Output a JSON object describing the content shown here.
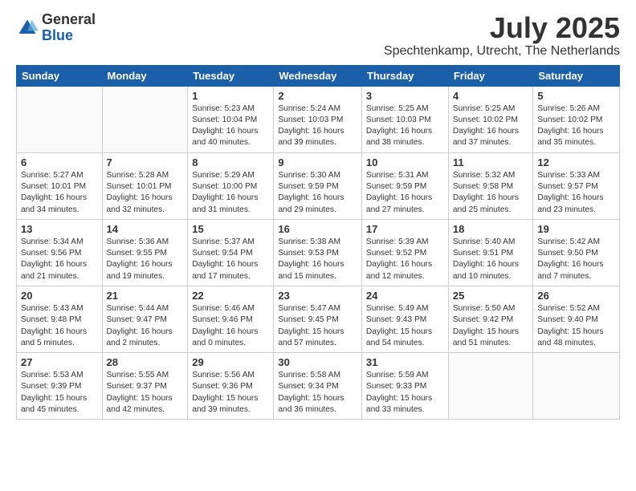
{
  "header": {
    "logo": {
      "general": "General",
      "blue": "Blue"
    },
    "title": "July 2025",
    "subtitle": "Spechtenkamp, Utrecht, The Netherlands"
  },
  "weekdays": [
    "Sunday",
    "Monday",
    "Tuesday",
    "Wednesday",
    "Thursday",
    "Friday",
    "Saturday"
  ],
  "weeks": [
    [
      {
        "day": "",
        "content": ""
      },
      {
        "day": "",
        "content": ""
      },
      {
        "day": "1",
        "content": "Sunrise: 5:23 AM\nSunset: 10:04 PM\nDaylight: 16 hours\nand 40 minutes."
      },
      {
        "day": "2",
        "content": "Sunrise: 5:24 AM\nSunset: 10:03 PM\nDaylight: 16 hours\nand 39 minutes."
      },
      {
        "day": "3",
        "content": "Sunrise: 5:25 AM\nSunset: 10:03 PM\nDaylight: 16 hours\nand 38 minutes."
      },
      {
        "day": "4",
        "content": "Sunrise: 5:25 AM\nSunset: 10:02 PM\nDaylight: 16 hours\nand 37 minutes."
      },
      {
        "day": "5",
        "content": "Sunrise: 5:26 AM\nSunset: 10:02 PM\nDaylight: 16 hours\nand 35 minutes."
      }
    ],
    [
      {
        "day": "6",
        "content": "Sunrise: 5:27 AM\nSunset: 10:01 PM\nDaylight: 16 hours\nand 34 minutes."
      },
      {
        "day": "7",
        "content": "Sunrise: 5:28 AM\nSunset: 10:01 PM\nDaylight: 16 hours\nand 32 minutes."
      },
      {
        "day": "8",
        "content": "Sunrise: 5:29 AM\nSunset: 10:00 PM\nDaylight: 16 hours\nand 31 minutes."
      },
      {
        "day": "9",
        "content": "Sunrise: 5:30 AM\nSunset: 9:59 PM\nDaylight: 16 hours\nand 29 minutes."
      },
      {
        "day": "10",
        "content": "Sunrise: 5:31 AM\nSunset: 9:59 PM\nDaylight: 16 hours\nand 27 minutes."
      },
      {
        "day": "11",
        "content": "Sunrise: 5:32 AM\nSunset: 9:58 PM\nDaylight: 16 hours\nand 25 minutes."
      },
      {
        "day": "12",
        "content": "Sunrise: 5:33 AM\nSunset: 9:57 PM\nDaylight: 16 hours\nand 23 minutes."
      }
    ],
    [
      {
        "day": "13",
        "content": "Sunrise: 5:34 AM\nSunset: 9:56 PM\nDaylight: 16 hours\nand 21 minutes."
      },
      {
        "day": "14",
        "content": "Sunrise: 5:36 AM\nSunset: 9:55 PM\nDaylight: 16 hours\nand 19 minutes."
      },
      {
        "day": "15",
        "content": "Sunrise: 5:37 AM\nSunset: 9:54 PM\nDaylight: 16 hours\nand 17 minutes."
      },
      {
        "day": "16",
        "content": "Sunrise: 5:38 AM\nSunset: 9:53 PM\nDaylight: 16 hours\nand 15 minutes."
      },
      {
        "day": "17",
        "content": "Sunrise: 5:39 AM\nSunset: 9:52 PM\nDaylight: 16 hours\nand 12 minutes."
      },
      {
        "day": "18",
        "content": "Sunrise: 5:40 AM\nSunset: 9:51 PM\nDaylight: 16 hours\nand 10 minutes."
      },
      {
        "day": "19",
        "content": "Sunrise: 5:42 AM\nSunset: 9:50 PM\nDaylight: 16 hours\nand 7 minutes."
      }
    ],
    [
      {
        "day": "20",
        "content": "Sunrise: 5:43 AM\nSunset: 9:48 PM\nDaylight: 16 hours\nand 5 minutes."
      },
      {
        "day": "21",
        "content": "Sunrise: 5:44 AM\nSunset: 9:47 PM\nDaylight: 16 hours\nand 2 minutes."
      },
      {
        "day": "22",
        "content": "Sunrise: 5:46 AM\nSunset: 9:46 PM\nDaylight: 16 hours\nand 0 minutes."
      },
      {
        "day": "23",
        "content": "Sunrise: 5:47 AM\nSunset: 9:45 PM\nDaylight: 15 hours\nand 57 minutes."
      },
      {
        "day": "24",
        "content": "Sunrise: 5:49 AM\nSunset: 9:43 PM\nDaylight: 15 hours\nand 54 minutes."
      },
      {
        "day": "25",
        "content": "Sunrise: 5:50 AM\nSunset: 9:42 PM\nDaylight: 15 hours\nand 51 minutes."
      },
      {
        "day": "26",
        "content": "Sunrise: 5:52 AM\nSunset: 9:40 PM\nDaylight: 15 hours\nand 48 minutes."
      }
    ],
    [
      {
        "day": "27",
        "content": "Sunrise: 5:53 AM\nSunset: 9:39 PM\nDaylight: 15 hours\nand 45 minutes."
      },
      {
        "day": "28",
        "content": "Sunrise: 5:55 AM\nSunset: 9:37 PM\nDaylight: 15 hours\nand 42 minutes."
      },
      {
        "day": "29",
        "content": "Sunrise: 5:56 AM\nSunset: 9:36 PM\nDaylight: 15 hours\nand 39 minutes."
      },
      {
        "day": "30",
        "content": "Sunrise: 5:58 AM\nSunset: 9:34 PM\nDaylight: 15 hours\nand 36 minutes."
      },
      {
        "day": "31",
        "content": "Sunrise: 5:59 AM\nSunset: 9:33 PM\nDaylight: 15 hours\nand 33 minutes."
      },
      {
        "day": "",
        "content": ""
      },
      {
        "day": "",
        "content": ""
      }
    ]
  ]
}
